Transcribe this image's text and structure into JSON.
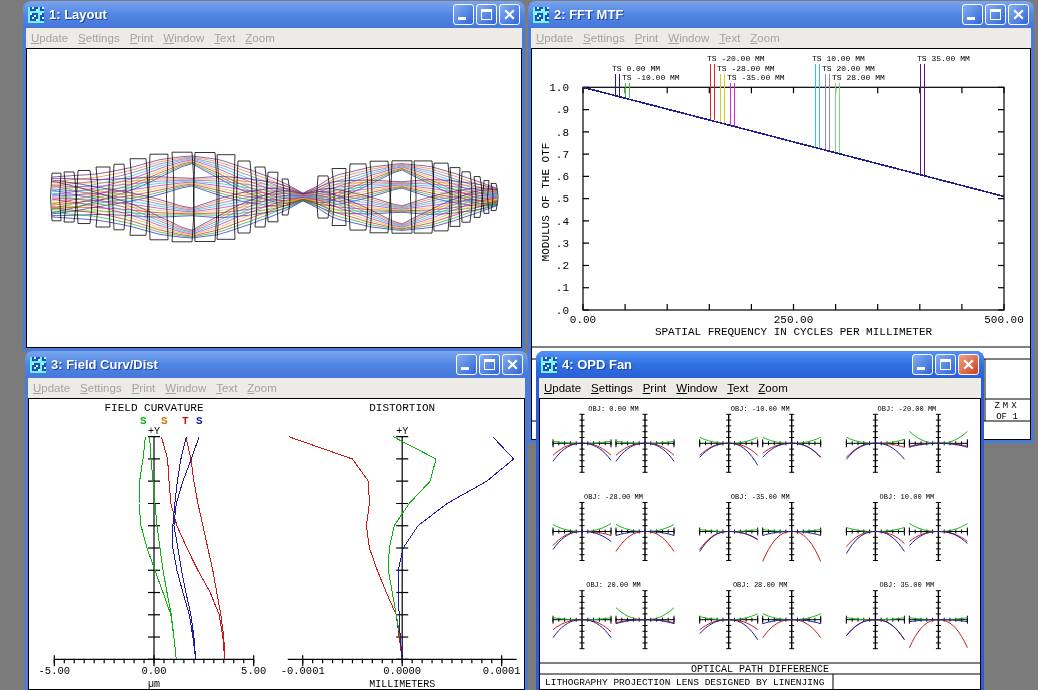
{
  "windows": [
    {
      "kind": "layout",
      "title": "1: Layout",
      "active": false,
      "menu": [
        "Update",
        "Settings",
        "Print",
        "Window",
        "Text",
        "Zoom"
      ]
    },
    {
      "kind": "mtf",
      "title": "2: FFT MTF",
      "active": false,
      "menu": [
        "Update",
        "Settings",
        "Print",
        "Window",
        "Text",
        "Zoom"
      ],
      "legend": [
        {
          "text": "TS 0.00 MM",
          "color": "#1c1c96"
        },
        {
          "text": "TS -10.00 MM",
          "color": "#3cc83c"
        },
        {
          "text": "TS -20.00 MM",
          "color": "#d42a2a"
        },
        {
          "text": "TS -28.00 MM",
          "color": "#d6cc28"
        },
        {
          "text": "TS -35.00 MM",
          "color": "#d42ad4"
        },
        {
          "text": "TS 10.00 MM",
          "color": "#28c8d4"
        },
        {
          "text": "TS 20.00 MM",
          "color": "#9a86c8"
        },
        {
          "text": "TS 28.00 MM",
          "color": "#7cd67c"
        },
        {
          "text": "TS 35.00 MM",
          "color": "#5e1470"
        }
      ],
      "chart_data": {
        "type": "line",
        "xlabel": "SPATIAL FREQUENCY IN CYCLES PER MILLIMETER",
        "ylabel": "MODULUS OF THE OTF",
        "x": [
          0,
          50,
          100,
          150,
          200,
          250,
          300,
          350,
          400,
          450,
          500
        ],
        "xlim": [
          0,
          500
        ],
        "ylim": [
          0,
          1
        ],
        "xticks": [
          {
            "value": 0,
            "label": "0.00"
          },
          {
            "value": 250,
            "label": "250.00"
          },
          {
            "value": 500,
            "label": "500.00"
          }
        ],
        "yticks": [
          {
            "value": 0,
            "label": ".0"
          },
          {
            "value": 0.1,
            "label": ".1"
          },
          {
            "value": 0.2,
            "label": ".2"
          },
          {
            "value": 0.3,
            "label": ".3"
          },
          {
            "value": 0.4,
            "label": ".4"
          },
          {
            "value": 0.5,
            "label": ".5"
          },
          {
            "value": 0.6,
            "label": ".6"
          },
          {
            "value": 0.7,
            "label": ".7"
          },
          {
            "value": 0.8,
            "label": ".8"
          },
          {
            "value": 0.9,
            "label": ".9"
          },
          {
            "value": 1,
            "label": "1.0"
          }
        ],
        "series": [
          {
            "color": "#24208a",
            "values": [
              1,
              0.951,
              0.902,
              0.853,
              0.804,
              0.755,
              0.706,
              0.657,
              0.608,
              0.559,
              0.51
            ]
          }
        ]
      },
      "footer": [
        "ZMX",
        "OF 1"
      ]
    },
    {
      "kind": "field",
      "title": "3: Field Curv/Dist",
      "active": false,
      "menu": [
        "Update",
        "Settings",
        "Print",
        "Window",
        "Text",
        "Zoom"
      ],
      "field_curvature": {
        "legend": [
          {
            "text": "S",
            "color": "#10b010"
          },
          {
            "text": "S",
            "color": "#d07800"
          },
          {
            "text": "T",
            "color": "#c81818"
          },
          {
            "text": "S",
            "color": "#1c1ca0"
          }
        ],
        "chart_data": {
          "type": "line",
          "title": "FIELD CURVATURE",
          "xlabel": "µm",
          "ylabel": "+Y",
          "orientation": "horizontal",
          "categories": [
            null,
            null,
            null,
            null,
            null,
            null,
            null,
            null,
            null,
            null,
            null
          ],
          "xlim": [
            -5,
            5
          ],
          "xticks": [
            {
              "value": -5,
              "label": "-5.00"
            },
            {
              "value": 0,
              "label": "0.00"
            },
            {
              "value": 5,
              "label": "5.00"
            }
          ],
          "series": [
            {
              "color": "#10b010",
              "values": [
                -0.43,
                -0.55,
                -0.72,
                -0.75,
                -0.65,
                -0.35,
                0.05,
                0.45,
                0.85,
                1.0,
                1.12
              ]
            },
            {
              "color": "#10b010",
              "values": [
                -0.22,
                -0.15,
                -0.05,
                0.05,
                0.15,
                0.3,
                0.45,
                0.65,
                0.87,
                1.0,
                1.12
              ]
            },
            {
              "color": "#c81818",
              "values": [
                0.37,
                0.68,
                0.75,
                0.85,
                1.15,
                1.65,
                2.2,
                2.82,
                3.27,
                3.45,
                3.55
              ]
            },
            {
              "color": "#c81818",
              "values": [
                1.6,
                1.85,
                2.0,
                2.2,
                2.45,
                2.7,
                2.95,
                3.15,
                3.35,
                3.5,
                3.55
              ]
            },
            {
              "color": "#1c1ca0",
              "values": [
                1.62,
                1.35,
                1.17,
                1.05,
                0.95,
                0.95,
                1.15,
                1.45,
                1.77,
                1.95,
                2.09
              ]
            },
            {
              "color": "#1c1ca0",
              "values": [
                2.26,
                1.87,
                1.45,
                1.12,
                1.0,
                1.2,
                1.38,
                1.6,
                1.85,
                2.0,
                2.09
              ]
            }
          ]
        }
      },
      "distortion": {
        "chart_data": {
          "type": "line",
          "title": "DISTORTION",
          "xlabel": "MILLIMETERS",
          "ylabel": "+Y",
          "orientation": "horizontal",
          "categories": [
            null,
            null,
            null,
            null,
            null,
            null,
            null,
            null,
            null,
            null,
            null
          ],
          "xlim": [
            -0.000115,
            0.000115
          ],
          "xticks": [
            {
              "value": -0.0001,
              "label": "-0.0001"
            },
            {
              "value": 0,
              "label": "0.0000"
            },
            {
              "value": 0.0001,
              "label": "0.0001"
            }
          ],
          "series": [
            {
              "color": "#c81818",
              "values": [
                -0.000114,
                -5e-05,
                -3.4e-05,
                -3.3e-05,
                -3.6e-05,
                -3.3e-05,
                -2.5e-05,
                -1.6e-05,
                -6e-06,
                -3e-06,
                0
              ]
            },
            {
              "color": "#10b010",
              "values": [
                -9e-06,
                3.4e-05,
                2.8e-05,
                7e-06,
                -8e-06,
                -1.3e-05,
                -1.4e-05,
                -1e-05,
                -6e-06,
                -2e-06,
                0
              ]
            },
            {
              "color": "#1c1ca0",
              "values": [
                9.1e-05,
                0.000112,
                8.5e-05,
                4.5e-05,
                1.6e-05,
                1e-06,
                -4e-06,
                -4e-06,
                -3e-06,
                -2e-06,
                0
              ]
            }
          ]
        }
      }
    },
    {
      "kind": "opd",
      "title": "4: OPD Fan",
      "active": true,
      "menu": [
        "Update",
        "Settings",
        "Print",
        "Window",
        "Text",
        "Zoom"
      ],
      "plots": [
        {
          "title": "OBJ: 0.00 MM"
        },
        {
          "title": "OBJ: -10.00 MM"
        },
        {
          "title": "OBJ: -20.00 MM"
        },
        {
          "title": "OBJ: -28.00 MM"
        },
        {
          "title": "OBJ: -35.00 MM"
        },
        {
          "title": "OBJ: 10.00 MM"
        },
        {
          "title": "OBJ: 20.00 MM"
        },
        {
          "title": "OBJ: 28.00 MM"
        },
        {
          "title": "OBJ: 35.00 MM"
        }
      ],
      "footer": {
        "title": "OPTICAL PATH DIFFERENCE",
        "description": "LITHOGRAPHY PROJECTION LENS DESIGNED BY LINENJING"
      }
    }
  ]
}
